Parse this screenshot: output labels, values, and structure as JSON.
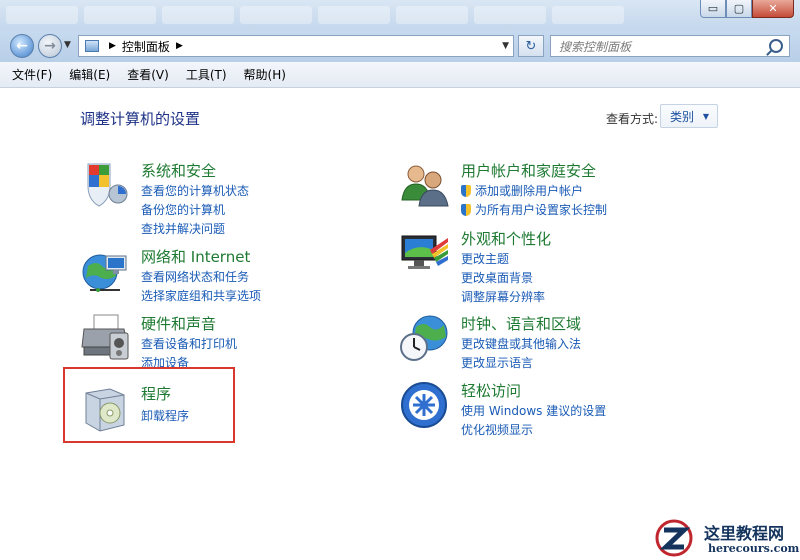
{
  "window": {
    "controls": {
      "minimize": "▭",
      "maximize": "▢",
      "close": "✕"
    }
  },
  "address": {
    "path_item": "控制面板",
    "search_placeholder": "搜索控制面板"
  },
  "menu": [
    "文件(F)",
    "编辑(E)",
    "查看(V)",
    "工具(T)",
    "帮助(H)"
  ],
  "content": {
    "title": "调整计算机的设置",
    "view_by_label": "查看方式:",
    "view_by_value": "类别"
  },
  "categories": {
    "system_security": {
      "title": "系统和安全",
      "links": [
        "查看您的计算机状态",
        "备份您的计算机",
        "查找并解决问题"
      ],
      "icon": "shield-icon"
    },
    "network_internet": {
      "title": "网络和 Internet",
      "links": [
        "查看网络状态和任务",
        "选择家庭组和共享选项"
      ],
      "icon": "globe-network-icon"
    },
    "hardware_sound": {
      "title": "硬件和声音",
      "links": [
        "查看设备和打印机",
        "添加设备"
      ],
      "icon": "printer-icon"
    },
    "programs": {
      "title": "程序",
      "links": [
        "卸载程序"
      ],
      "icon": "programs-box-icon"
    },
    "user_accounts": {
      "title": "用户帐户和家庭安全",
      "links": [
        "添加或删除用户帐户",
        "为所有用户设置家长控制"
      ],
      "icon": "users-icon"
    },
    "appearance": {
      "title": "外观和个性化",
      "links": [
        "更改主题",
        "更改桌面背景",
        "调整屏幕分辨率"
      ],
      "icon": "monitor-palette-icon"
    },
    "clock_region": {
      "title": "时钟、语言和区域",
      "links": [
        "更改键盘或其他输入法",
        "更改显示语言"
      ],
      "icon": "clock-globe-icon"
    },
    "ease_access": {
      "title": "轻松访问",
      "links": [
        "使用 Windows 建议的设置",
        "优化视频显示"
      ],
      "icon": "ease-of-access-icon"
    }
  },
  "watermark": {
    "title": "这里教程网",
    "subtitle": "herecours.com"
  }
}
